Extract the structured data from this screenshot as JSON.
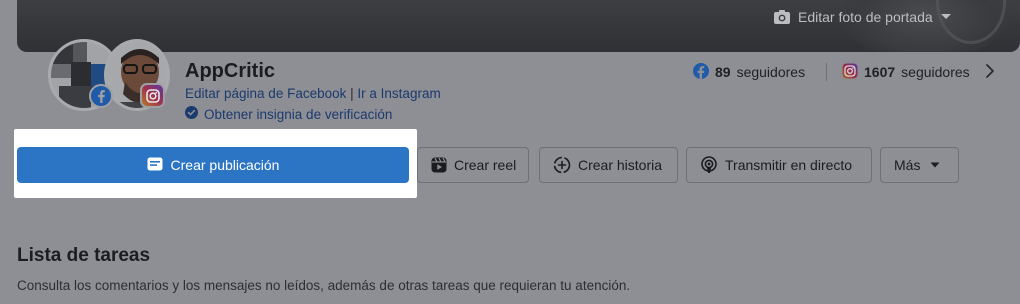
{
  "cover": {
    "edit_label": "Editar foto de portada",
    "camera_icon": "camera-icon",
    "dropdown_icon": "caret-down-icon"
  },
  "profile": {
    "name": "AppCritic",
    "edit_page_link": "Editar página de Facebook",
    "separator": "|",
    "instagram_link": "Ir a Instagram",
    "verify_label": "Obtener insignia de verificación",
    "verify_icon": "verified-check-icon"
  },
  "followers": {
    "facebook": {
      "count": "89",
      "label": "seguidores",
      "icon": "facebook-icon"
    },
    "instagram": {
      "count": "1607",
      "label": "seguidores",
      "icon": "instagram-icon"
    },
    "more_icon": "chevron-right-icon"
  },
  "actions": {
    "create_post": "Crear publicación",
    "create_reel": "Crear reel",
    "create_story": "Crear historia",
    "go_live": "Transmitir en directo",
    "more": "Más"
  },
  "tasks": {
    "title": "Lista de tareas",
    "description": "Consulta los comentarios y los mensajes no leídos, además de otras tareas que requieran tu atención."
  },
  "colors": {
    "primary": "#2b75c4",
    "link": "#1b3a6e",
    "facebook_blue": "#1f5ba8",
    "overlay_gray": "#8e8f94"
  }
}
